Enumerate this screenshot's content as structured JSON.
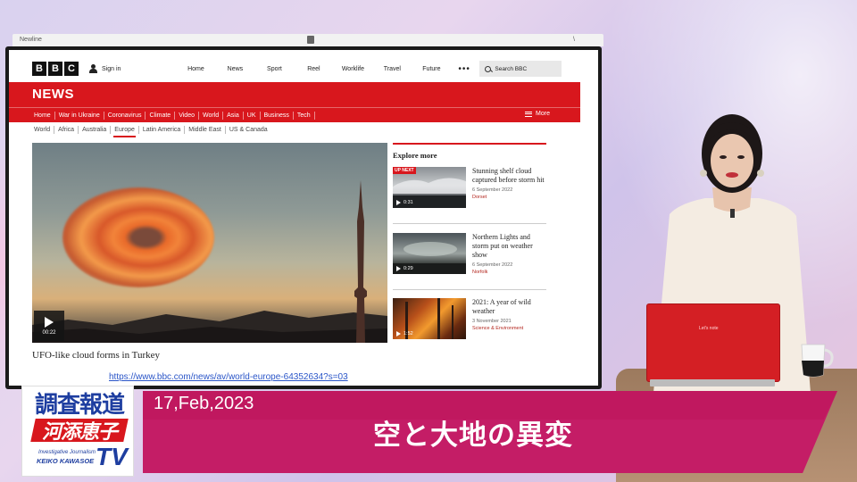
{
  "monitor": {
    "window_label": "Newline",
    "corner_mark": "\\"
  },
  "bbc": {
    "logo_letters": [
      "B",
      "B",
      "C"
    ],
    "signin": "Sign in",
    "topnav": [
      "Home",
      "News",
      "Sport",
      "Reel",
      "Worklife",
      "Travel",
      "Future"
    ],
    "more_dots": "•••",
    "search_placeholder": "Search BBC",
    "news_title": "NEWS",
    "news_nav": [
      "Home",
      "War in Ukraine",
      "Coronavirus",
      "Climate",
      "Video",
      "World",
      "Asia",
      "UK",
      "Business",
      "Tech"
    ],
    "news_nav_more": "More",
    "sub_nav": [
      "World",
      "Africa",
      "Australia",
      "Europe",
      "Latin America",
      "Middle East",
      "US & Canada"
    ],
    "sub_nav_active": "Europe",
    "main_video": {
      "duration": "00:22",
      "caption": "UFO-like cloud forms in Turkey"
    },
    "explore_title": "Explore more",
    "explore_items": [
      {
        "badge": "UP NEXT",
        "duration": "0:31",
        "headline": "Stunning shelf cloud captured before storm hit",
        "date": "6 September 2022",
        "tag": "Dorset"
      },
      {
        "badge": "",
        "duration": "0:29",
        "headline": "Northern Lights and storm put on weather show",
        "date": "6 September 2022",
        "tag": "Norfolk"
      },
      {
        "badge": "",
        "duration": "1:52",
        "headline": "2021: A year of wild weather",
        "date": "3 November 2021",
        "tag": "Science & Environment"
      }
    ]
  },
  "url": "https://www.bbc.com/news/av/world-europe-64352634?s=03",
  "laptop_brand": "Let's note",
  "lower_third": {
    "date": "17,Feb,2023",
    "headline": "空と大地の異変"
  },
  "logo": {
    "top": "調査報道",
    "name": "河添恵子",
    "sub1": "Investigative Journalism",
    "sub2": "KEIKO KAWASOE",
    "tv": "TV"
  },
  "colors": {
    "bbc_red": "#d8171d",
    "band_magenta": "#c41d66",
    "logo_blue": "#1e3ea0"
  }
}
